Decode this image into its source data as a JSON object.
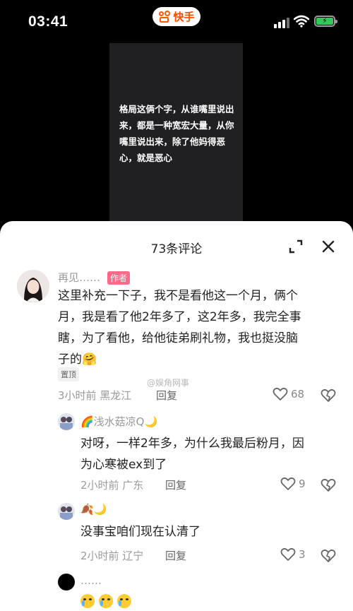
{
  "status_bar": {
    "time": "03:41",
    "app_name": "快手",
    "accent": "#ff5a00"
  },
  "video": {
    "caption": "格局这俩个字，从谁嘴里说出来，都是一种宽宏大量，从你嘴里说出来，除了他妈得恶心，就是恶心"
  },
  "comments_sheet": {
    "title": "73条评论",
    "expand_icon": "expand-icon",
    "close_icon": "close-icon",
    "watermark": "@娱角网事",
    "comments": [
      {
        "name": "再见……",
        "badge": "作者",
        "text_lines": [
          "这里补充一下子，我不是看他这一个月，俩个",
          "月，我是看了他2年多了，这2年多，我完全事",
          "瞎，为了看他，给他徒弟刷礼物，我也挺没脑",
          "子的🤗"
        ],
        "pin": "置顶",
        "meta": "3小时前 黑龙江",
        "reply_label": "回复",
        "likes": "68"
      },
      {
        "name": "🌈浅水菇凉Q🌙",
        "text_lines": [
          "对呀，一样2年多，为什么我最后粉月，因",
          "为心寒被ex到了"
        ],
        "meta": "2小时前 广东",
        "reply_label": "回复",
        "likes": "9"
      },
      {
        "name": "🍂🌙",
        "text_lines": [
          "没事宝咱们现在认清了"
        ],
        "meta": "2小时前 辽宁",
        "reply_label": "回复",
        "likes": "3"
      },
      {
        "name": "……",
        "emoji_count": 3
      }
    ]
  }
}
